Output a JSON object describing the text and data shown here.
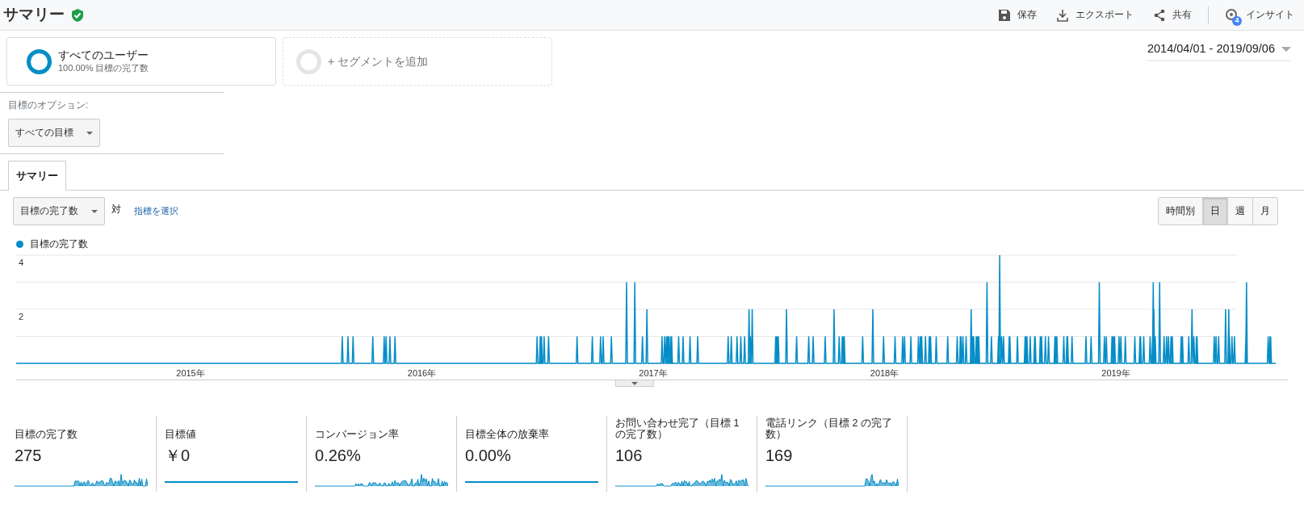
{
  "header": {
    "title": "サマリー",
    "verified": true,
    "actions": [
      {
        "label": "保存",
        "kind": "save"
      },
      {
        "label": "エクスポート",
        "kind": "export"
      },
      {
        "label": "共有",
        "kind": "share"
      },
      {
        "label": "インサイト",
        "kind": "insight",
        "badge": "4"
      }
    ]
  },
  "segments": [
    {
      "kind": "active",
      "title": "すべてのユーザー",
      "subtitle": "100.00% 目標の完了数"
    },
    {
      "kind": "add",
      "title": "+ セグメントを追加"
    }
  ],
  "date_range": "2014/04/01 - 2019/09/06",
  "goal_option": {
    "label": "目標のオプション:",
    "value": "すべての目標"
  },
  "tabs": [
    {
      "label": "サマリー",
      "selected": true
    }
  ],
  "metric_picker": {
    "value": "目標の完了数",
    "versus": "対",
    "link": "指標を選択"
  },
  "granularity": [
    {
      "label": "時間別",
      "selected": false
    },
    {
      "label": "日",
      "selected": true
    },
    {
      "label": "週",
      "selected": false
    },
    {
      "label": "月",
      "selected": false
    }
  ],
  "chart": {
    "legend": "目標の完了数",
    "y_labels": [
      "4",
      "2"
    ],
    "x_labels": [
      "2015年",
      "2016年",
      "2017年",
      "2018年",
      "2019年"
    ]
  },
  "scorecards": [
    {
      "label": "目標の完了数",
      "value": "275",
      "kind": "activity"
    },
    {
      "label": "目標値",
      "value": "￥0",
      "kind": "flat"
    },
    {
      "label": "コンバージョン率",
      "value": "0.26%",
      "kind": "activity"
    },
    {
      "label": "目標全体の放棄率",
      "value": "0.00%",
      "kind": "flat"
    },
    {
      "label": "お問い合わせ完了（目標 1 の完了数）",
      "value": "106",
      "kind": "activity"
    },
    {
      "label": "電話リンク（目標 2 の完了数）",
      "value": "169",
      "kind": "activity"
    }
  ]
}
